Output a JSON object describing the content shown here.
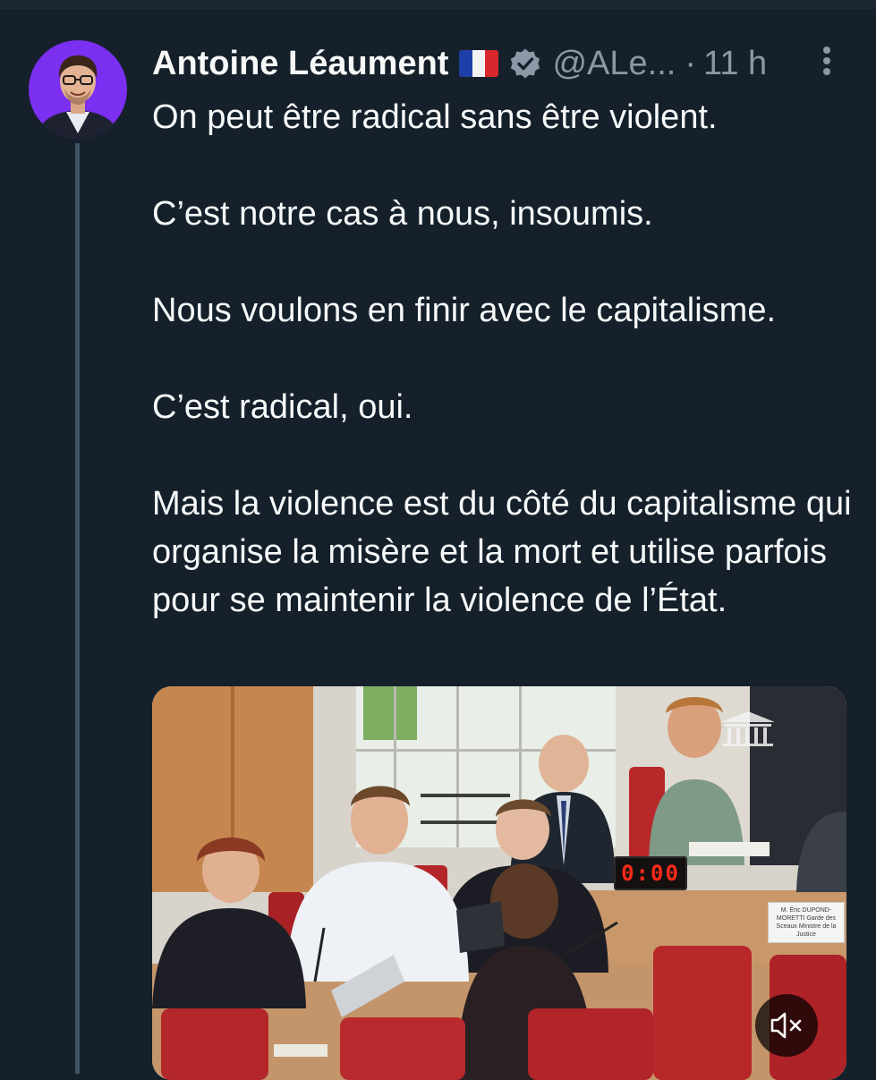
{
  "tweet": {
    "author_name": "Antoine Léaument",
    "handle": "@ALe...",
    "separator": "·",
    "timestamp": "11 h",
    "paragraphs": [
      "On peut être radical sans être violent.",
      "C’est notre cas à nous, insoumis.",
      "Nous voulons en finir avec le capitalisme.",
      "C’est radical, oui.",
      "Mais la violence est du côté du capitalisme qui organise la misère et la mort et utilise parfois pour se maintenir la violence de l’État."
    ]
  },
  "badges": {
    "flag_icon": "france-flag-icon",
    "verified_icon": "verified-badge-icon",
    "verified_color": "#8b98a5"
  },
  "media": {
    "timer_display": "0:00",
    "nameplate_text": "M. Éric DUPOND-MORETTI Garde des Sceaux Ministre de la Justice",
    "mute_icon": "volume-muted-icon"
  },
  "colors": {
    "background": "#15202b",
    "text": "#f7f9f9",
    "secondary_text": "#8b98a5",
    "thread_line": "#3d5466",
    "avatar_bg": "#7b2ff0"
  }
}
